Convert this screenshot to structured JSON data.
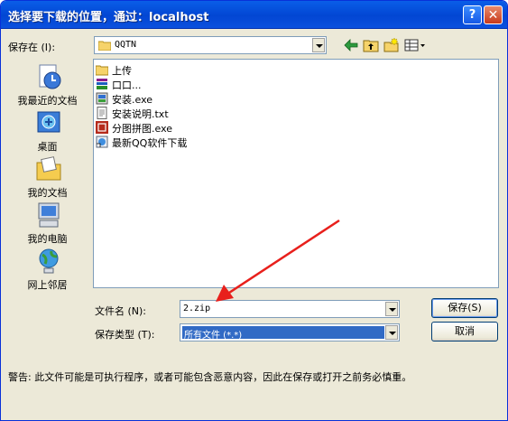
{
  "dialog": {
    "title": "选择要下载的位置，通过：localhost",
    "help_label": "?",
    "close_label": "✕"
  },
  "save_in": {
    "label": "保存在 (I):",
    "value": "QQTN"
  },
  "places": [
    {
      "label": "我最近的文档",
      "icon": "recent-documents-icon"
    },
    {
      "label": "桌面",
      "icon": "desktop-icon"
    },
    {
      "label": "我的文档",
      "icon": "my-documents-icon"
    },
    {
      "label": "我的电脑",
      "icon": "my-computer-icon"
    },
    {
      "label": "网上邻居",
      "icon": "network-places-icon"
    }
  ],
  "files": [
    {
      "name": "上传",
      "icon": "folder-icon"
    },
    {
      "name": "口口...",
      "icon": "archive-icon"
    },
    {
      "name": "安装.exe",
      "icon": "installer-icon"
    },
    {
      "name": "安装说明.txt",
      "icon": "text-file-icon"
    },
    {
      "name": "分图拼图.exe",
      "icon": "app-icon"
    },
    {
      "name": "最新QQ软件下载",
      "icon": "shortcut-icon"
    }
  ],
  "filename": {
    "label": "文件名 (N):",
    "value": "2.zip"
  },
  "filetype": {
    "label": "保存类型 (T):",
    "value": "所有文件 (*.*)"
  },
  "buttons": {
    "save": "保存(S)",
    "cancel": "取消"
  },
  "warning": "警告: 此文件可能是可执行程序，或者可能包含恶意内容，因此在保存或打开之前务必慎重。",
  "colors": {
    "titlebar": "#0246d3",
    "arrow": "#e8201c",
    "selection": "#316ac5"
  }
}
